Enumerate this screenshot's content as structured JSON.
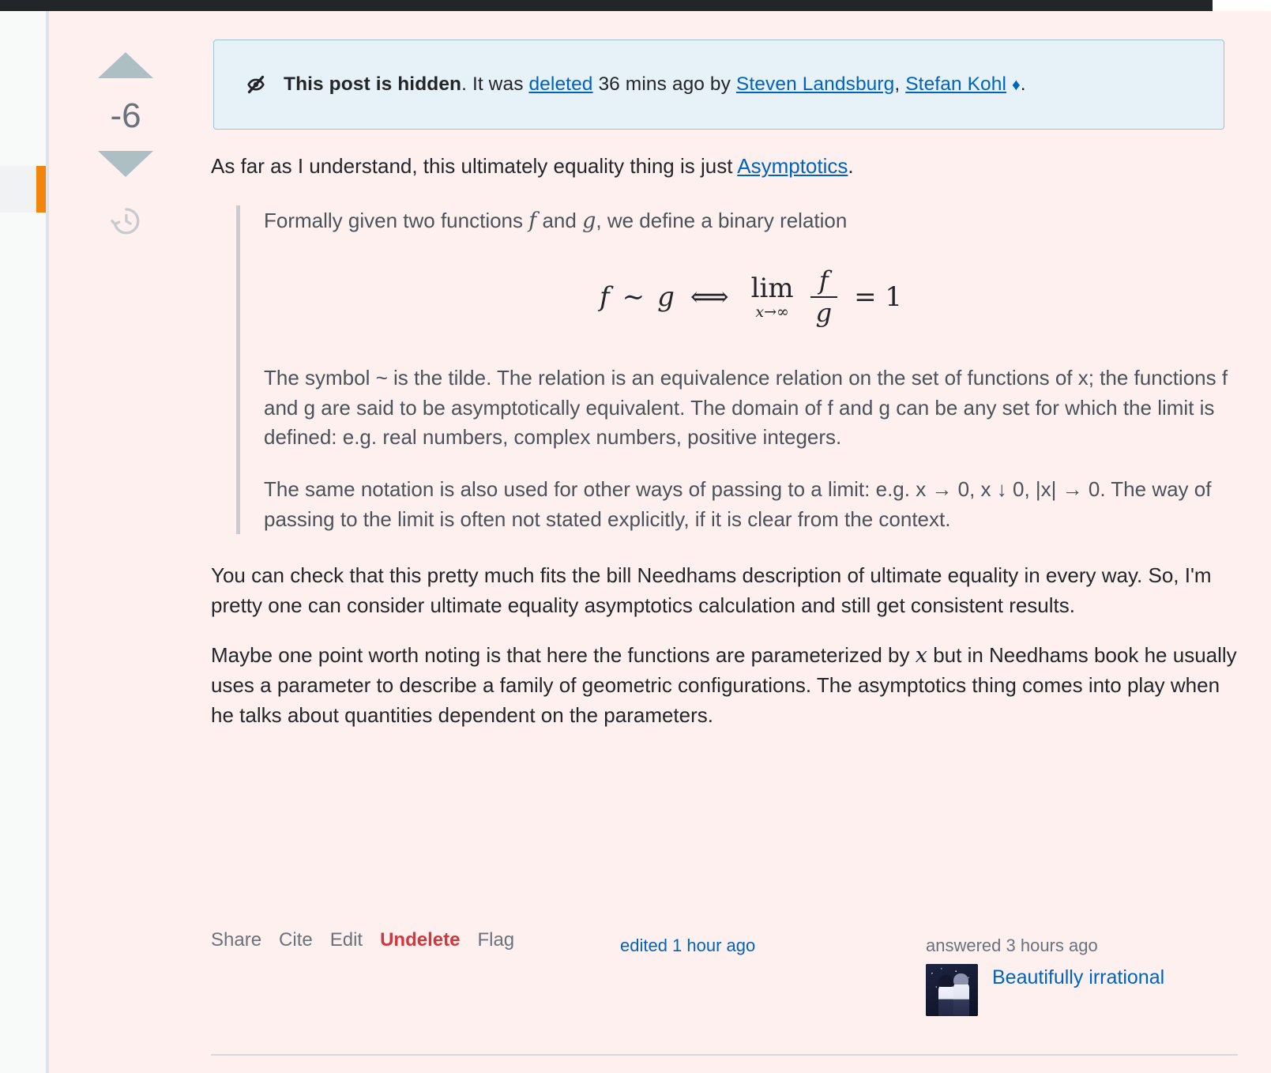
{
  "post": {
    "vote": {
      "score": "-6",
      "up_icon": "upvote-triangle",
      "down_icon": "downvote-triangle",
      "history_icon": "history-clock-icon"
    },
    "notice": {
      "icon": "hidden-eye-slash-icon",
      "title": "This post is hidden",
      "text_before_link": ". It was ",
      "link_deleted": "deleted",
      "text_after_link": " 36 mins ago by ",
      "user_one": "Steven Landsburg",
      "separator": ", ",
      "user_two": "Stefan Kohl",
      "mod_diamond": "♦",
      "period": ".",
      "bg_color": "#e7f1f8",
      "border_color": "#9cc3db"
    },
    "intro": {
      "text_before": "As far as I understand, this ultimately equality thing is just ",
      "link": "Asymptotics",
      "text_after": "."
    },
    "quote": {
      "para1_before": "Formally given two functions ",
      "para1_f": "f",
      "para1_mid": " and ",
      "para1_g": "g",
      "para1_after": ", we define a binary relation",
      "formula": {
        "lhs_f": "f",
        "tilde": "∼",
        "lhs_g": "g",
        "iff": "⟺",
        "lim": "lim",
        "lim_sub": "x→∞",
        "frac_num": "f",
        "frac_den": "g",
        "equals_one": "= 1",
        "plain": "f ~ g ⟺ lim(x→∞) f/g = 1"
      },
      "para2": "The symbol ~ is the tilde. The relation is an equivalence relation on the set of functions of x; the functions f and g are said to be asymptotically equivalent. The domain of f and g can be any set for which the limit is defined: e.g. real numbers, complex numbers, positive integers.",
      "para3": "The same notation is also used for other ways of passing to a limit: e.g. x → 0, x ↓ 0, |x| → 0. The way of passing to the limit is often not stated explicitly, if it is clear from the context."
    },
    "para_after_quote": "You can check that this pretty much fits the bill Needhams description of ultimate equality in every way. So, I'm pretty one can consider ultimate equality asymptotics calculation and still get consistent results.",
    "para_final_before": "Maybe one point worth noting is that here the functions are parameterized by ",
    "para_final_var": "x",
    "para_final_after": " but in Needhams book he usually uses a parameter to describe a family of geometric configurations. The asymptotics thing comes into play when he talks about quantities dependent on the parameters.",
    "footer": {
      "actions": [
        {
          "label": "Share",
          "name": "share"
        },
        {
          "label": "Cite",
          "name": "cite"
        },
        {
          "label": "Edit",
          "name": "edit"
        },
        {
          "label": "Undelete",
          "name": "undelete"
        },
        {
          "label": "Flag",
          "name": "flag"
        }
      ],
      "edited": "edited 1 hour ago",
      "answered": "answered 3 hours ago",
      "username": "Beautifully irrational",
      "avatar_icon": "user-avatar-anime-night"
    }
  },
  "colors": {
    "deleted_post_bg": "#fdf0ef",
    "notice_bg": "#e7f1f8",
    "link_blue": "#0063bf",
    "undelete_red": "#d1383d",
    "sidebar_accent_orange": "#f2860c",
    "topbar_dark": "#232629"
  }
}
